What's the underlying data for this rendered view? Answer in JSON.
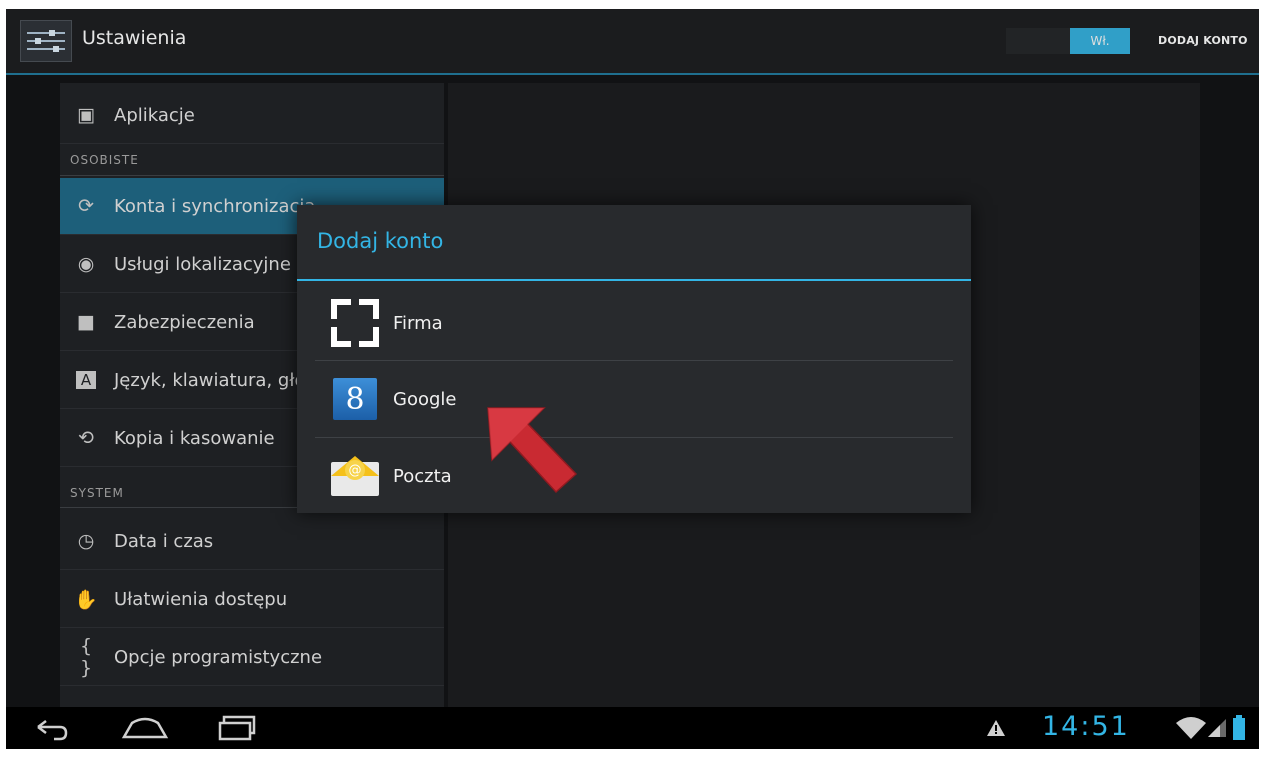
{
  "actionbar": {
    "title": "Ustawienia",
    "wifi_switch_label": "Wł.",
    "add_account_label": "DODAJ KONTO"
  },
  "settings": {
    "items_top": [
      {
        "label": "Aplikacje",
        "icon": "apps-icon"
      }
    ],
    "section_personal": "OSOBISTE",
    "items_personal": [
      {
        "label": "Konta i synchronizacja",
        "icon": "sync-icon",
        "active": true
      },
      {
        "label": "Usługi lokalizacyjne",
        "icon": "location-icon"
      },
      {
        "label": "Zabezpieczenia",
        "icon": "lock-icon"
      },
      {
        "label": "Język, klawiatura, głos",
        "icon": "keyboard-icon"
      },
      {
        "label": "Kopia i kasowanie",
        "icon": "backup-icon"
      }
    ],
    "section_system": "SYSTEM",
    "items_system": [
      {
        "label": "Data i czas",
        "icon": "clock-icon"
      },
      {
        "label": "Ułatwienia dostępu",
        "icon": "hand-icon"
      },
      {
        "label": "Opcje programistyczne",
        "icon": "braces-icon"
      }
    ]
  },
  "dialog": {
    "title": "Dodaj konto",
    "options": [
      {
        "label": "Firma",
        "icon": "corporate-icon"
      },
      {
        "label": "Google",
        "icon": "google-icon",
        "glyph": "8"
      },
      {
        "label": "Poczta",
        "icon": "email-icon",
        "glyph": "@"
      }
    ]
  },
  "statusbar": {
    "time": "14:51",
    "accent_color": "#33b5e5"
  }
}
